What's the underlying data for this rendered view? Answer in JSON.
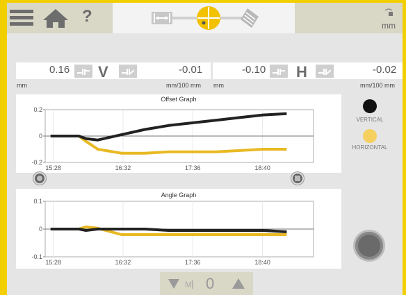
{
  "colors": {
    "accent": "#f2cf00",
    "vertical": "#222222",
    "horizontal": "#e8b923"
  },
  "toolbar": {
    "menu_icon": "hamburger-menu-icon",
    "home_icon": "home-icon",
    "help_label": "?",
    "unit_label": "mm"
  },
  "readouts": {
    "vertical": {
      "offset": "0.16",
      "axis": "V",
      "angle": "-0.01",
      "unit_left": "mm",
      "unit_right": "mm/100 mm"
    },
    "horizontal": {
      "offset": "-0.10",
      "axis": "H",
      "angle": "-0.02",
      "unit_left": "mm",
      "unit_right": "mm/100 mm"
    }
  },
  "legend": {
    "vertical": "VERTICAL",
    "horizontal": "HORIZONTAL"
  },
  "bottom": {
    "value": "0"
  },
  "chart_data": [
    {
      "type": "line",
      "title": "Offset Graph",
      "xlabel": "",
      "ylabel": "",
      "x_ticks": [
        "15:28",
        "16:32",
        "17:36",
        "18:40"
      ],
      "y_ticks": [
        "0.2",
        "0",
        "-0.2"
      ],
      "ylim": [
        -0.2,
        0.2
      ],
      "grid": true,
      "series": [
        {
          "name": "VERTICAL",
          "x": [
            0,
            0.04,
            0.12,
            0.15,
            0.2,
            0.3,
            0.4,
            0.5,
            0.6,
            0.7,
            0.8,
            0.9,
            1
          ],
          "values": [
            0,
            0,
            0,
            -0.02,
            -0.03,
            0.01,
            0.05,
            0.08,
            0.1,
            0.12,
            0.14,
            0.16,
            0.17
          ]
        },
        {
          "name": "HORIZONTAL",
          "x": [
            0,
            0.04,
            0.12,
            0.15,
            0.2,
            0.3,
            0.4,
            0.5,
            0.6,
            0.7,
            0.8,
            0.9,
            1
          ],
          "values": [
            0,
            0,
            0,
            -0.04,
            -0.1,
            -0.13,
            -0.13,
            -0.12,
            -0.12,
            -0.12,
            -0.11,
            -0.1,
            -0.1
          ]
        }
      ]
    },
    {
      "type": "line",
      "title": "Angle Graph",
      "xlabel": "",
      "ylabel": "",
      "x_ticks": [
        "15:28",
        "16:32",
        "17:36",
        "18:40"
      ],
      "y_ticks": [
        "0.1",
        "0",
        "-0.1"
      ],
      "ylim": [
        -0.1,
        0.1
      ],
      "grid": true,
      "series": [
        {
          "name": "VERTICAL",
          "x": [
            0,
            0.12,
            0.15,
            0.2,
            0.3,
            0.4,
            0.5,
            0.6,
            0.7,
            0.8,
            0.9,
            1
          ],
          "values": [
            0,
            0,
            -0.005,
            0,
            0,
            0,
            -0.005,
            -0.005,
            -0.005,
            -0.005,
            -0.005,
            -0.01
          ]
        },
        {
          "name": "HORIZONTAL",
          "x": [
            0,
            0.12,
            0.15,
            0.2,
            0.3,
            0.4,
            0.5,
            0.6,
            0.7,
            0.8,
            0.9,
            1
          ],
          "values": [
            0,
            0,
            0.008,
            0.003,
            -0.02,
            -0.02,
            -0.02,
            -0.02,
            -0.02,
            -0.02,
            -0.02,
            -0.02
          ]
        }
      ]
    }
  ]
}
